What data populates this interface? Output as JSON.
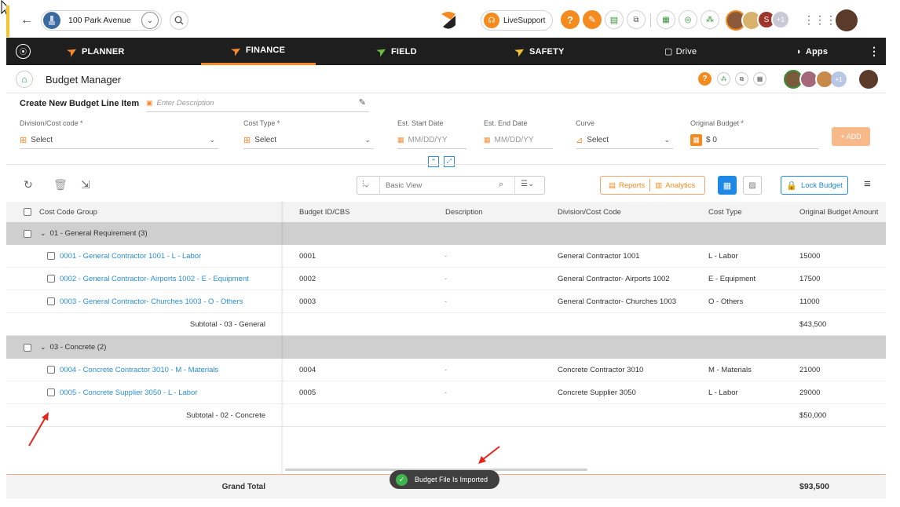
{
  "topbar": {
    "project_name": "100 Park Avenue",
    "live_support": "LiveSupport",
    "avatar_badge": "S",
    "avatar_more": "+1"
  },
  "nav": {
    "items": [
      {
        "label": "PLANNER",
        "active": false
      },
      {
        "label": "FINANCE",
        "active": true
      },
      {
        "label": "FIELD",
        "active": false
      },
      {
        "label": "SAFETY",
        "active": false
      },
      {
        "label": "Drive",
        "active": false
      },
      {
        "label": "Apps",
        "active": false
      }
    ]
  },
  "page": {
    "title": "Budget Manager",
    "avatar_more": "+1"
  },
  "create": {
    "title": "Create New Budget Line Item",
    "description_placeholder": "Enter Description",
    "division_label": "Division/Cost code *",
    "division_value": "Select",
    "cost_type_label": "Cost Type *",
    "cost_type_value": "Select",
    "start_label": "Est. Start Date",
    "start_placeholder": "MM/DD/YY",
    "end_label": "Est. End Date",
    "end_placeholder": "MM/DD/YY",
    "curve_label": "Curve",
    "curve_value": "Select",
    "budget_label": "Original Budget *",
    "budget_value": "$ 0",
    "add_label": "+ ADD"
  },
  "toolbar": {
    "view_placeholder": "Basic View",
    "reports_label": "Reports",
    "analytics_label": "Analytics",
    "lock_label": "Lock Budget"
  },
  "grid": {
    "headers": [
      "Cost Code Group",
      "Budget ID/CBS",
      "Description",
      "Division/Cost Code",
      "Cost Type",
      "Original Budget Amount"
    ],
    "groups": [
      {
        "label": "01 - General Requirement (3)",
        "rows": [
          {
            "name": "0001 - General Contractor 1001 - L - Labor",
            "id": "0001",
            "desc": "-",
            "division": "General Contractor 1001",
            "type": "L - Labor",
            "amount": "15000"
          },
          {
            "name": "0002 - General Contractor- Airports 1002 - E - Equipment",
            "id": "0002",
            "desc": "-",
            "division": "General Contractor- Airports 1002",
            "type": "E - Equipment",
            "amount": "17500"
          },
          {
            "name": "0003 - General Contractor- Churches 1003 - O - Others",
            "id": "0003",
            "desc": "-",
            "division": "General Contractor- Churches 1003",
            "type": "O - Others",
            "amount": "11000"
          }
        ],
        "subtotal_label": "Subtotal - 03 - General",
        "subtotal_value": "$43,500"
      },
      {
        "label": "03 - Concrete (2)",
        "rows": [
          {
            "name": "0004 - Concrete Contractor 3010 - M - Materials",
            "id": "0004",
            "desc": "-",
            "division": "Concrete Contractor 3010",
            "type": "M - Materials",
            "amount": "21000"
          },
          {
            "name": "0005 - Concrete Supplier 3050 - L - Labor",
            "id": "0005",
            "desc": "-",
            "division": "Concrete Supplier 3050",
            "type": "L - Labor",
            "amount": "29000"
          }
        ],
        "subtotal_label": "Subtotal - 02 - Concrete",
        "subtotal_value": "$50,000"
      }
    ],
    "grand_total_label": "Grand Total",
    "grand_total_value": "$93,500"
  },
  "toast": {
    "message": "Budget File Is Imported"
  },
  "colors": {
    "accent": "#f7892a",
    "link": "#2a8fd8",
    "nav_bg": "#1e1e1e",
    "toast_bg": "#3f3f3f",
    "annotation": "#e8231c"
  }
}
